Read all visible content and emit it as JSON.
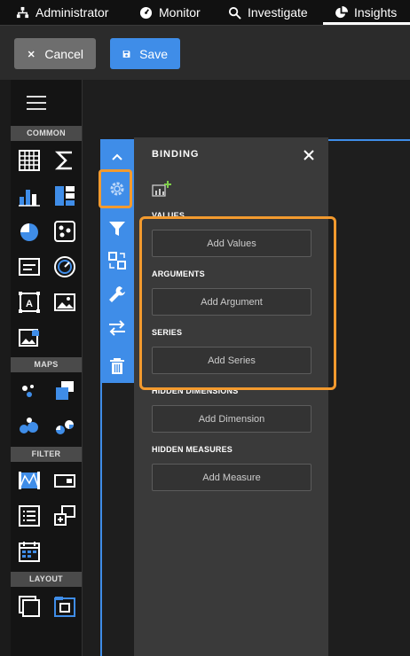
{
  "nav": {
    "items": [
      {
        "label": "Administrator",
        "icon": "sitemap-icon"
      },
      {
        "label": "Monitor",
        "icon": "gauge-icon"
      },
      {
        "label": "Investigate",
        "icon": "search-icon"
      },
      {
        "label": "Insights",
        "icon": "pie-chart-icon",
        "active": true
      }
    ]
  },
  "toolbar": {
    "cancel_label": "Cancel",
    "save_label": "Save"
  },
  "toolbox": {
    "sections": {
      "common": "COMMON",
      "maps": "MAPS",
      "filter": "FILTER",
      "layout": "LAYOUT"
    }
  },
  "panel": {
    "title": "BINDING",
    "fields": [
      {
        "label": "VALUES",
        "button": "Add Values"
      },
      {
        "label": "ARGUMENTS",
        "button": "Add Argument"
      },
      {
        "label": "SERIES",
        "button": "Add Series"
      },
      {
        "label": "HIDDEN DIMENSIONS",
        "button": "Add Dimension"
      },
      {
        "label": "HIDDEN MEASURES",
        "button": "Add Measure"
      }
    ]
  },
  "colors": {
    "accent": "#3f8de8",
    "highlight": "#f39a2e",
    "panel_bg": "#3a3a3a"
  }
}
